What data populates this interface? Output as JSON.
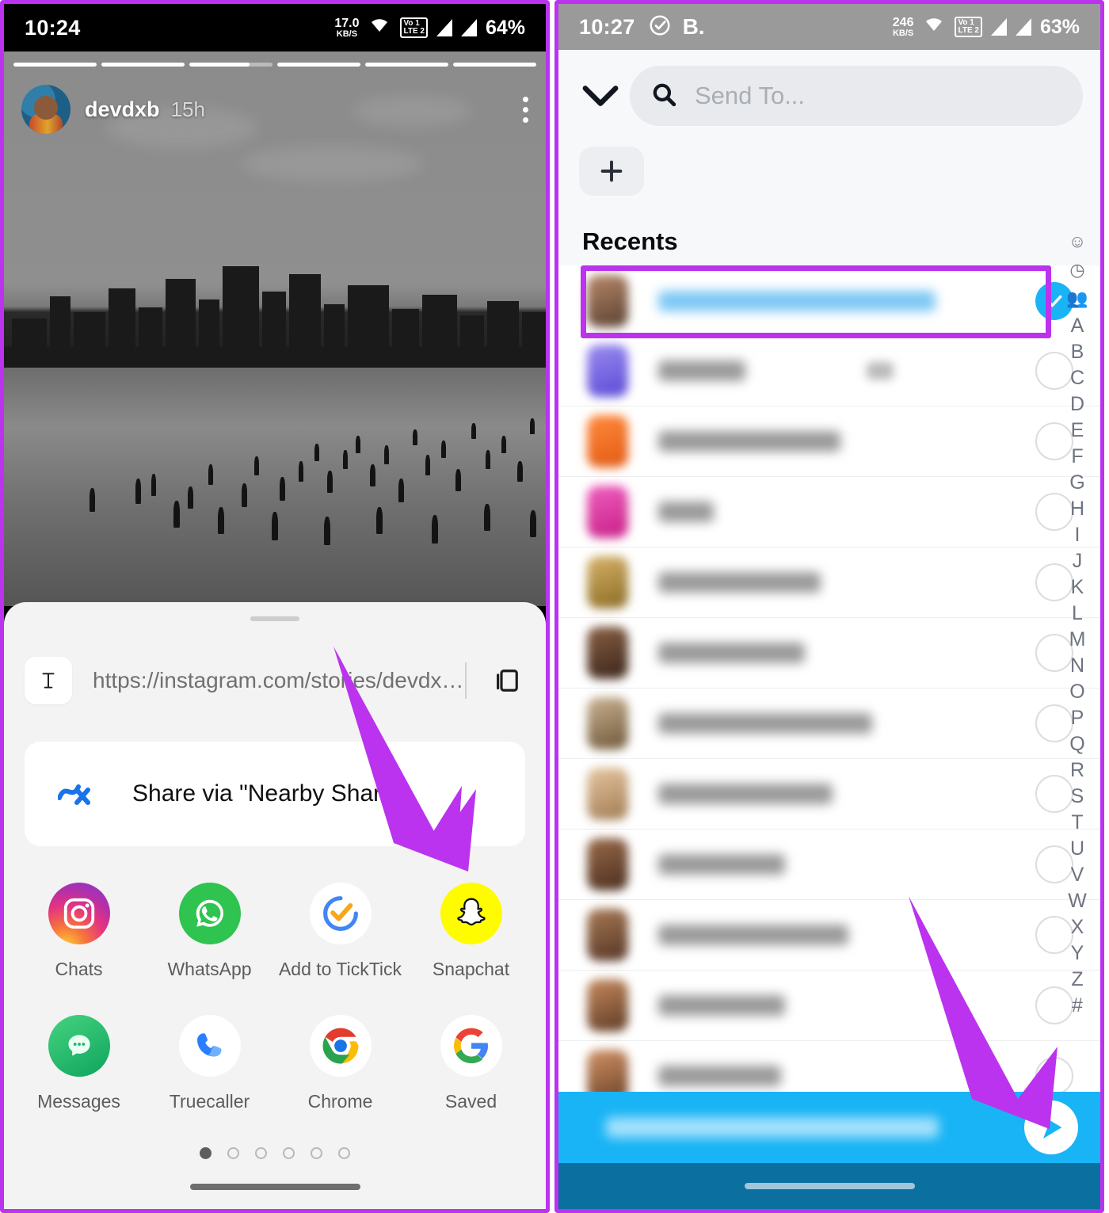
{
  "left_phone": {
    "status_bar": {
      "time": "10:24",
      "net_speed_value": "17.0",
      "net_speed_unit": "KB/S",
      "wifi_icon": "wifi-icon",
      "volte_top": "Vo 1",
      "volte_bottom": "LTE 2",
      "signal_1_icon": "signal-bars-icon",
      "signal_2_icon": "signal-bars-icon",
      "battery": "64%"
    },
    "story": {
      "username": "devdxb",
      "time_ago": "15h",
      "segments_total": 6,
      "active_segment_index": 2,
      "active_segment_fill_percent": 72,
      "more_icon": "kebab-menu-icon",
      "avatar_icon": "profile-avatar"
    },
    "share_sheet": {
      "grabber_icon": "drag-handle",
      "text_preview_icon": "text-icon",
      "url": "https://instagram.com/stories/devdx…",
      "copy_icon": "copy-icon",
      "nearby_share_icon": "nearby-share-icon",
      "nearby_share_label": "Share via \"Nearby Share\"",
      "apps_row_1": [
        {
          "label": "Chats",
          "icon": "instagram-icon"
        },
        {
          "label": "WhatsApp",
          "icon": "whatsapp-icon"
        },
        {
          "label": "Add to TickTick",
          "icon": "ticktick-icon"
        },
        {
          "label": "Snapchat",
          "icon": "snapchat-icon"
        }
      ],
      "apps_row_2": [
        {
          "label": "Messages",
          "icon": "messages-icon"
        },
        {
          "label": "Truecaller",
          "icon": "truecaller-icon"
        },
        {
          "label": "Chrome",
          "icon": "chrome-icon"
        },
        {
          "label": "Saved",
          "icon": "google-icon"
        }
      ],
      "pager_dots_total": 6,
      "pager_active_index": 0
    },
    "nav_bar": {
      "home_pill_icon": "gesture-pill"
    }
  },
  "right_phone": {
    "status_bar": {
      "time": "10:27",
      "clock_check_icon": "check-circle-icon",
      "app_badge": "B.",
      "net_speed_value": "246",
      "net_speed_unit": "KB/S",
      "wifi_icon": "wifi-icon",
      "volte_top": "Vo 1",
      "volte_bottom": "LTE 2",
      "signal_1_icon": "signal-bars-icon",
      "signal_2_icon": "signal-bars-icon",
      "battery": "63%"
    },
    "header": {
      "collapse_icon": "chevron-down-icon",
      "search_icon": "search-icon",
      "search_placeholder": "Send To...",
      "search_value": "",
      "add_icon": "plus-icon"
    },
    "section_title": "Recents",
    "contacts": [
      {
        "name_blurred": true,
        "name_width": 350,
        "selected": true,
        "avatar_color": "#8a6a52",
        "badge": false,
        "highlighted": true
      },
      {
        "name_blurred": true,
        "name_width": 110,
        "selected": false,
        "avatar_color": "#6d5ce0",
        "badge": true,
        "highlighted": false
      },
      {
        "name_blurred": true,
        "name_width": 230,
        "selected": false,
        "avatar_color": "#f2722b",
        "badge": false,
        "highlighted": false
      },
      {
        "name_blurred": true,
        "name_width": 70,
        "selected": false,
        "avatar_color": "#e0359e",
        "badge": false,
        "highlighted": false
      },
      {
        "name_blurred": true,
        "name_width": 205,
        "selected": false,
        "avatar_color": "#b08a3d",
        "badge": false,
        "highlighted": false
      },
      {
        "name_blurred": true,
        "name_width": 185,
        "selected": false,
        "avatar_color": "#5a3b2a",
        "badge": false,
        "highlighted": false
      },
      {
        "name_blurred": true,
        "name_width": 270,
        "selected": false,
        "avatar_color": "#8d7257",
        "badge": false,
        "highlighted": false
      },
      {
        "name_blurred": true,
        "name_width": 220,
        "selected": false,
        "avatar_color": "#c7a07a",
        "badge": false,
        "highlighted": false
      },
      {
        "name_blurred": true,
        "name_width": 160,
        "selected": false,
        "avatar_color": "#6f4a33",
        "badge": false,
        "highlighted": false
      },
      {
        "name_blurred": true,
        "name_width": 240,
        "selected": false,
        "avatar_color": "#7a5a42",
        "badge": false,
        "highlighted": false
      },
      {
        "name_blurred": true,
        "name_width": 160,
        "selected": false,
        "avatar_color": "#9a6a4a",
        "badge": false,
        "highlighted": false
      },
      {
        "name_blurred": true,
        "name_width": 155,
        "selected": false,
        "avatar_color": "#b5764e",
        "badge": false,
        "highlighted": false
      }
    ],
    "alpha_index": {
      "icons": [
        "emoji-icon",
        "clock-icon",
        "group-icon"
      ],
      "letters": [
        "A",
        "B",
        "C",
        "D",
        "E",
        "F",
        "G",
        "H",
        "I",
        "J",
        "K",
        "L",
        "M",
        "N",
        "O",
        "P",
        "Q",
        "R",
        "S",
        "T",
        "U",
        "V",
        "W",
        "X",
        "Y",
        "Z",
        "#"
      ]
    },
    "send_bar": {
      "recipient_blurred": true,
      "send_icon": "send-arrow-icon"
    },
    "nav_bar": {
      "home_pill_icon": "gesture-pill"
    }
  },
  "annotations": {
    "accent_color": "#bb33ee",
    "arrow_1_name": "arrow-pointing-to-snapchat",
    "arrow_2_name": "arrow-pointing-to-send-button",
    "highlight_box_name": "highlight-selected-contact"
  }
}
